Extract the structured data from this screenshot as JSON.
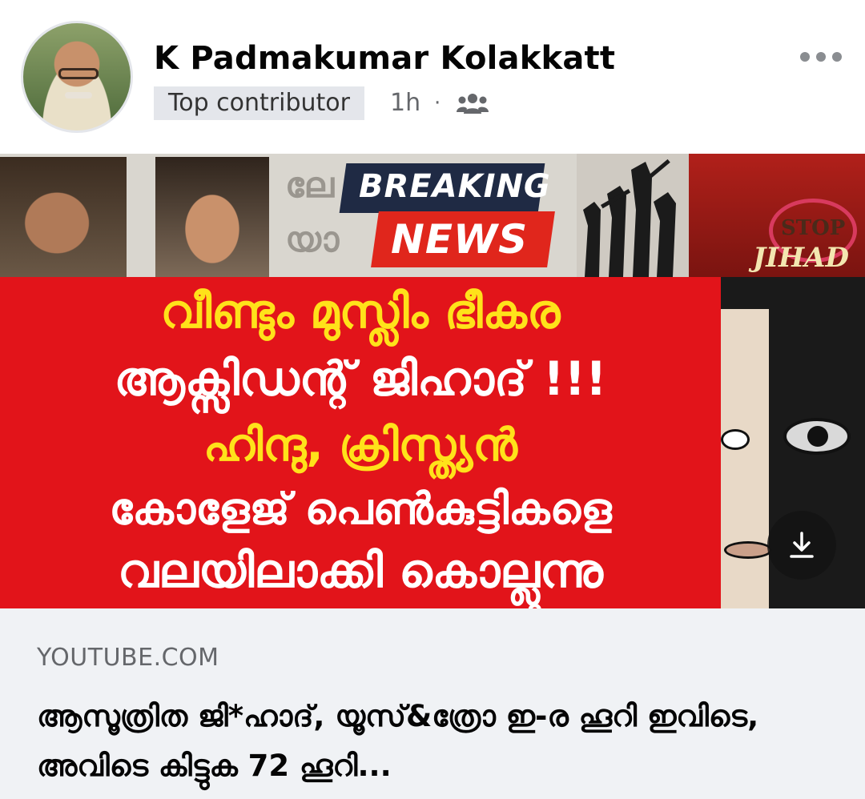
{
  "post": {
    "author": "K Padmakumar Kolakkatt",
    "badge": "Top contributor",
    "time": "1h",
    "separator": "·"
  },
  "icons": {
    "avatar": "avatar",
    "audience": "people-icon",
    "more": "more-horizontal-icon",
    "download": "download-icon"
  },
  "thumbnail": {
    "breaking": "BREAKING",
    "news": "NEWS",
    "stop": "STOP",
    "jihad": "JIHAD",
    "ghost_top": "ലേ",
    "ghost_bottom": "യാ",
    "headline": [
      "വീണ്ടും മുസ്ലിം ഭീകര",
      "ആക്സിഡന്റ് ജിഹാദ് !!!",
      "ഹിന്ദു, ക്രിസ്ത്യൻ",
      "കോളേജ് പെൺകുട്ടികളെ",
      "വലയിലാക്കി കൊല്ലുന്നു"
    ]
  },
  "link": {
    "domain": "YOUTUBE.COM",
    "title": "ആസൂത്രിത ജി*ഹാദ്, യൂസ്&ത്രോ ഇ-ര ഹൂറി ഇവിടെ, അവിടെ കിട്ടുക 72 ഹൂറി..."
  },
  "colors": {
    "badge_bg": "#e4e6eb",
    "card_bg": "#f0f2f5",
    "headline_red": "#e2141a",
    "headline_yellow": "#ffe21a"
  }
}
